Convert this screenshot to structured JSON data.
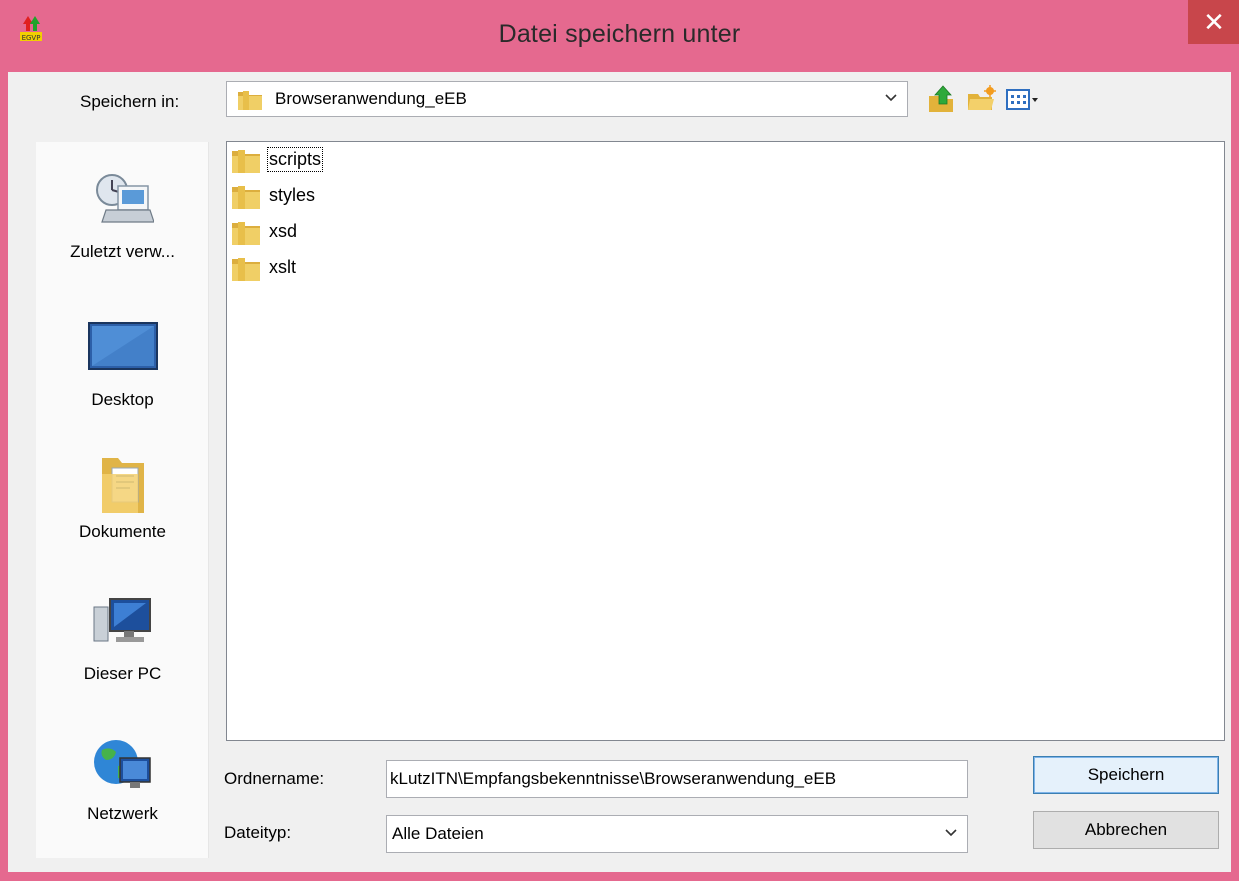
{
  "window": {
    "title": "Datei speichern unter",
    "close_label": "✕"
  },
  "save_in": {
    "label": "Speichern in:",
    "value": "Browseranwendung_eEB"
  },
  "places": [
    {
      "label": "Zuletzt verw...",
      "icon": "recent-places-icon"
    },
    {
      "label": "Desktop",
      "icon": "desktop-icon"
    },
    {
      "label": "Dokumente",
      "icon": "documents-icon"
    },
    {
      "label": "Dieser PC",
      "icon": "computer-icon"
    },
    {
      "label": "Netzwerk",
      "icon": "network-icon"
    }
  ],
  "files": [
    {
      "name": "scripts",
      "selected": true
    },
    {
      "name": "styles",
      "selected": false
    },
    {
      "name": "xsd",
      "selected": false
    },
    {
      "name": "xslt",
      "selected": false
    }
  ],
  "folder_name": {
    "label": "Ordnername:",
    "value": "kLutzITN\\Empfangsbekenntnisse\\Browseranwendung_eEB"
  },
  "file_type": {
    "label": "Dateityp:",
    "value": "Alle Dateien"
  },
  "buttons": {
    "save": "Speichern",
    "cancel": "Abbrechen"
  },
  "colors": {
    "titlebar": "#e5698f",
    "close_button": "#c8464b",
    "folder": "#e8c45a",
    "dialog_bg": "#f0f0f0"
  }
}
